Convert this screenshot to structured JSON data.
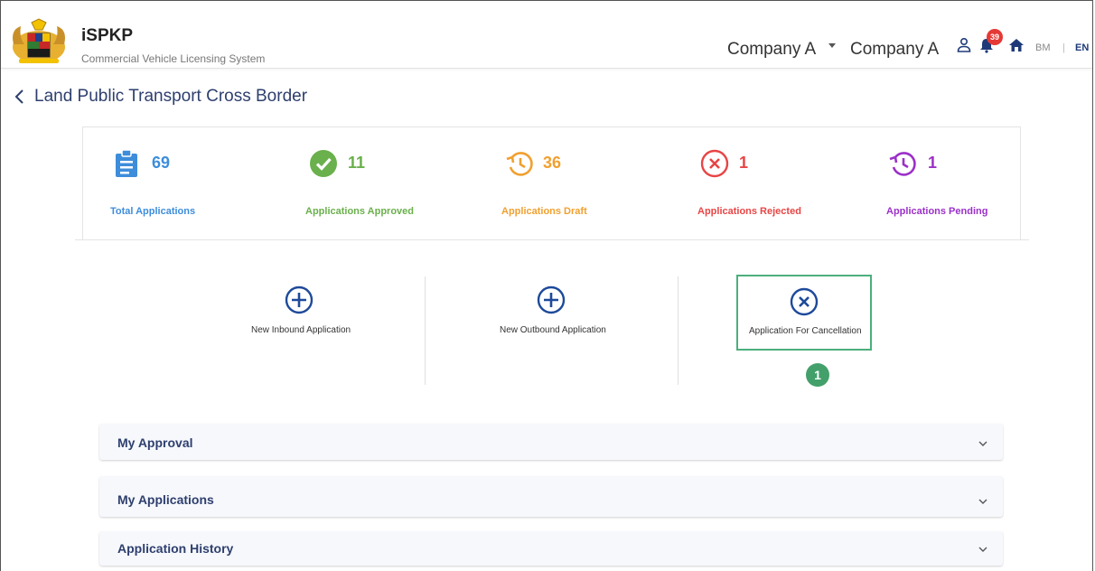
{
  "header": {
    "app_name": "iSPKP",
    "app_subtitle": "Commercial Vehicle Licensing System",
    "company_select": "Company A",
    "company_name": "Company A",
    "notification_count": "39",
    "lang_bm": "BM",
    "lang_sep": "|",
    "lang_en": "EN"
  },
  "page": {
    "title": "Land Public Transport Cross Border"
  },
  "stats": [
    {
      "value": "69",
      "label": "Total Applications",
      "color": "#3d8ddb"
    },
    {
      "value": "11",
      "label": "Applications Approved",
      "color": "#6ab04c"
    },
    {
      "value": "36",
      "label": "Applications Draft",
      "color": "#f0a030"
    },
    {
      "value": "1",
      "label": "Applications Rejected",
      "color": "#e84545"
    },
    {
      "value": "1",
      "label": "Applications Pending",
      "color": "#9b30c8"
    }
  ],
  "actions": [
    {
      "label": "New Inbound Application"
    },
    {
      "label": "New Outbound Application"
    },
    {
      "label": "Application For Cancellation"
    }
  ],
  "step_badge": "1",
  "accordions": [
    {
      "title": "My Approval"
    },
    {
      "title": "My Applications"
    },
    {
      "title": "Application History"
    }
  ],
  "colors": {
    "primary": "#2e3f6e",
    "accent_blue": "#1e4a9a",
    "highlight": "#4caf7d"
  }
}
